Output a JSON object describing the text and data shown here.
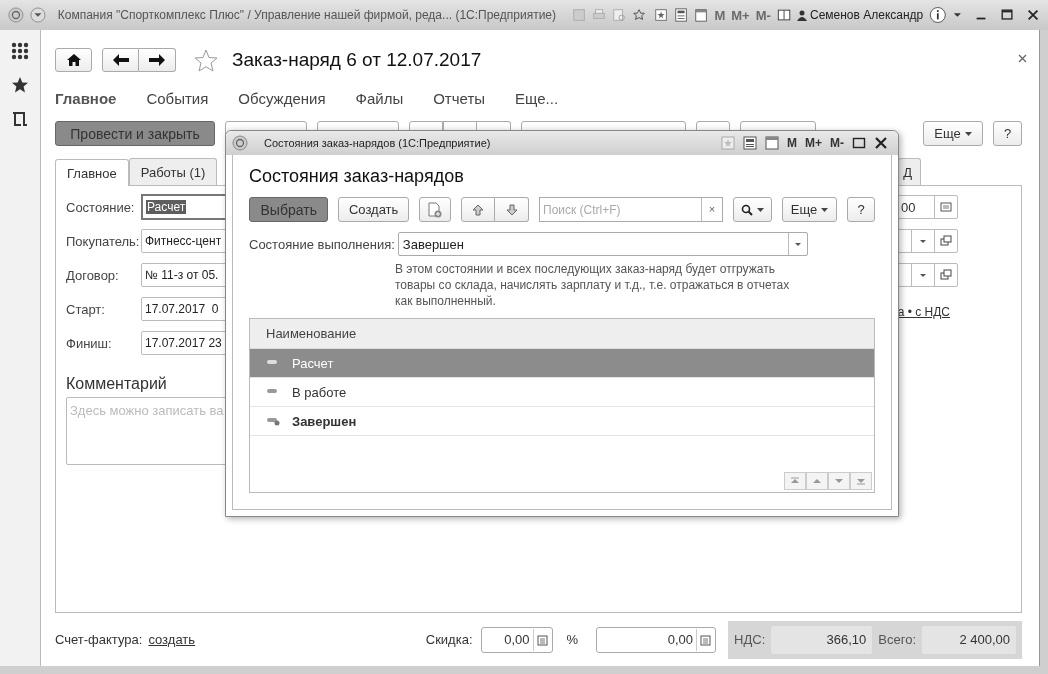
{
  "window": {
    "title": "Компания \"Спорткомплекс Плюс\" / Управление нашей фирмой, реда...  (1С:Предприятие)",
    "memory": [
      "M",
      "M+",
      "M-"
    ],
    "user": "Семенов Александр"
  },
  "document": {
    "title": "Заказ-наряд 6 от 12.07.2017",
    "sections": [
      {
        "label": "Главное",
        "selected": true
      },
      {
        "label": "События",
        "selected": false
      },
      {
        "label": "Обсуждения",
        "selected": false
      },
      {
        "label": "Файлы",
        "selected": false
      },
      {
        "label": "Отчеты",
        "selected": false
      },
      {
        "label": "Еще...",
        "selected": false
      }
    ],
    "toolbar": {
      "primary": "Провести и закрыть",
      "more": "Еще",
      "help": "?"
    },
    "tabs": [
      {
        "label": "Главное",
        "selected": true
      },
      {
        "label": "Работы (1)",
        "selected": false
      },
      {
        "label": "Д",
        "selected": false
      }
    ],
    "fields": [
      {
        "label": "Состояние:",
        "value": "Расчет",
        "focused": true
      },
      {
        "label": "Покупатель:",
        "value": "Фитнесс-цент",
        "focused": false
      },
      {
        "label": "Договор:",
        "value": "№ 11-з от 05.",
        "focused": false
      },
      {
        "label": "Старт:",
        "value": "17.07.2017  0",
        "focused": false
      },
      {
        "label": "Финиш:",
        "value": "17.07.2017 23",
        "focused": false
      }
    ],
    "right_fields": [
      {
        "kind": "number",
        "value": "00"
      },
      {
        "kind": "select"
      },
      {
        "kind": "select"
      },
      {
        "kind": "link",
        "text": "а • с НДС"
      }
    ],
    "comment": {
      "label": "Комментарий",
      "placeholder": "Здесь можно записать ва"
    },
    "footer": {
      "invoice_label": "Счет-фактура:",
      "invoice_link": "создать",
      "discount_label": "Скидка:",
      "discount": "0,00",
      "percent_label": "%",
      "amount": "0,00",
      "vat_label": "НДС:",
      "vat": "366,10",
      "total_label": "Всего:",
      "total": "2 400,00"
    }
  },
  "dialog": {
    "title": "Состояния заказ-нарядов  (1С:Предприятие)",
    "memory": [
      "M",
      "M+",
      "M-"
    ],
    "heading": "Состояния заказ-нарядов",
    "choose": "Выбрать",
    "create": "Создать",
    "search_placeholder": "Поиск (Ctrl+F)",
    "clear": "×",
    "more": "Еще",
    "help": "?",
    "filter_label": "Состояние выполнения:",
    "filter_value": "Завершен",
    "hint": "В этом состоянии и всех последующих заказ-наряд будет отгружать товары со склада, начислять зарплату и т.д., т.е. отражаться в отчетах как выполненный.",
    "column": "Наименование",
    "rows": [
      {
        "name": "Расчет",
        "selected": true,
        "current": false
      },
      {
        "name": "В работе",
        "selected": false,
        "current": false
      },
      {
        "name": "Завершен",
        "selected": false,
        "current": true
      }
    ]
  }
}
